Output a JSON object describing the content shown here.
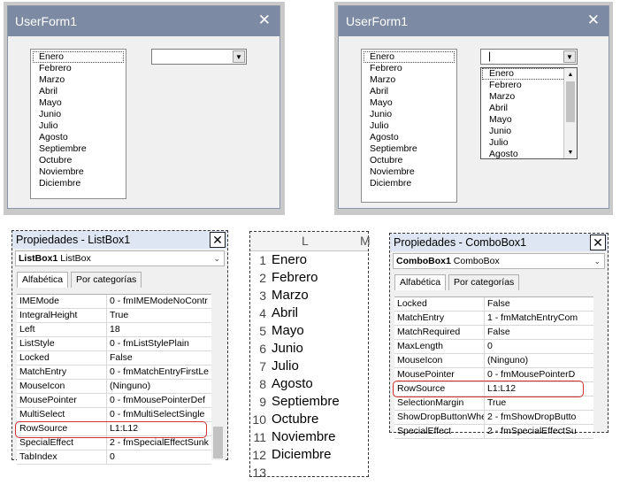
{
  "months": [
    "Enero",
    "Febrero",
    "Marzo",
    "Abril",
    "Mayo",
    "Junio",
    "Julio",
    "Agosto",
    "Septiembre",
    "Octubre",
    "Noviembre",
    "Diciembre"
  ],
  "form_left": {
    "title": "UserForm1",
    "close": "✕",
    "combo_arrow": "▼"
  },
  "form_right": {
    "title": "UserForm1",
    "close": "✕",
    "combo_arrow": "▼",
    "combo_value": "|",
    "scroll_up": "▲",
    "scroll_down": "▼"
  },
  "listbox_props": {
    "title": "Propiedades - ListBox1",
    "close": "✕",
    "object_name": "ListBox1",
    "object_type": "ListBox",
    "chevron": "⌄",
    "tabs": [
      "Alfabética",
      "Por categorías"
    ],
    "rows": [
      {
        "k": "IMEMode",
        "v": "0 - fmIMEModeNoContr"
      },
      {
        "k": "IntegralHeight",
        "v": "True"
      },
      {
        "k": "Left",
        "v": "18"
      },
      {
        "k": "ListStyle",
        "v": "0 - fmListStylePlain"
      },
      {
        "k": "Locked",
        "v": "False"
      },
      {
        "k": "MatchEntry",
        "v": "0 - fmMatchEntryFirstLe"
      },
      {
        "k": "MouseIcon",
        "v": "(Ninguno)"
      },
      {
        "k": "MousePointer",
        "v": "0 - fmMousePointerDef"
      },
      {
        "k": "MultiSelect",
        "v": "0 - fmMultiSelectSingle"
      },
      {
        "k": "RowSource",
        "v": "L1:L12"
      },
      {
        "k": "SpecialEffect",
        "v": "2 - fmSpecialEffectSunk"
      },
      {
        "k": "TabIndex",
        "v": "0"
      }
    ]
  },
  "combobox_props": {
    "title": "Propiedades - ComboBox1",
    "close": "✕",
    "object_name": "ComboBox1",
    "object_type": "ComboBox",
    "chevron": "⌄",
    "tabs": [
      "Alfabética",
      "Por categorías"
    ],
    "rows": [
      {
        "k": "Locked",
        "v": "False"
      },
      {
        "k": "MatchEntry",
        "v": "1 - fmMatchEntryCom"
      },
      {
        "k": "MatchRequired",
        "v": "False"
      },
      {
        "k": "MaxLength",
        "v": "0"
      },
      {
        "k": "MouseIcon",
        "v": "(Ninguno)"
      },
      {
        "k": "MousePointer",
        "v": "0 - fmMousePointerD"
      },
      {
        "k": "RowSource",
        "v": "L1:L12"
      },
      {
        "k": "SelectionMargin",
        "v": "True"
      },
      {
        "k": "ShowDropButtonWhen",
        "v": "2 - fmShowDropButto"
      },
      {
        "k": "SpecialEffect",
        "v": "2 - fmSpecialEffectSu"
      }
    ]
  },
  "sheet": {
    "column_label": "L",
    "next_column_label": "M",
    "row_numbers": [
      "1",
      "2",
      "3",
      "4",
      "5",
      "6",
      "7",
      "8",
      "9",
      "10",
      "11",
      "12",
      "13"
    ]
  }
}
